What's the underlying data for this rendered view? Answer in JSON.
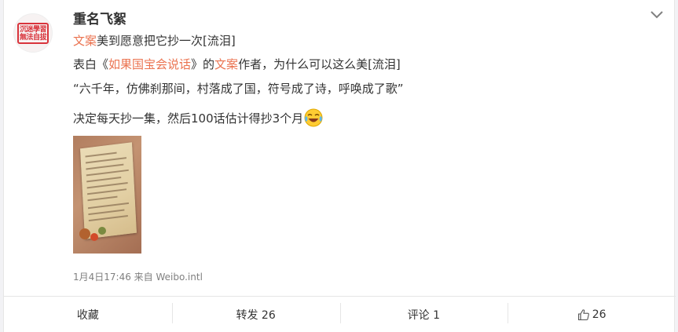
{
  "post": {
    "username": "重名飞絮",
    "avatar_text": [
      "沉迷學習",
      "無法自拔"
    ],
    "line1": {
      "link": "文案",
      "text": "美到愿意把它抄一次[流泪]"
    },
    "line2": {
      "prefix": "表白《",
      "link1": "如果国宝会说话",
      "mid": "》的",
      "link2": "文案",
      "suffix": "作者，为什么可以这么美[流泪]"
    },
    "line3": "“六千年，仿佛刹那间，村落成了国，符号成了诗，呼唤成了歌”",
    "line4": {
      "text": "决定每天抄一集，然后100话估计得抄3个月",
      "emoji": "laugh-cry-emoji"
    },
    "meta": "1月4日17:46 来自 Weibo.intl"
  },
  "toolbar": {
    "favorite": "收藏",
    "repost": "转发 26",
    "comment": "评论 1",
    "like_count": "26"
  },
  "colors": {
    "link": "#eb7350",
    "text": "#333333",
    "meta": "#808080",
    "stamp": "#d9343c"
  }
}
